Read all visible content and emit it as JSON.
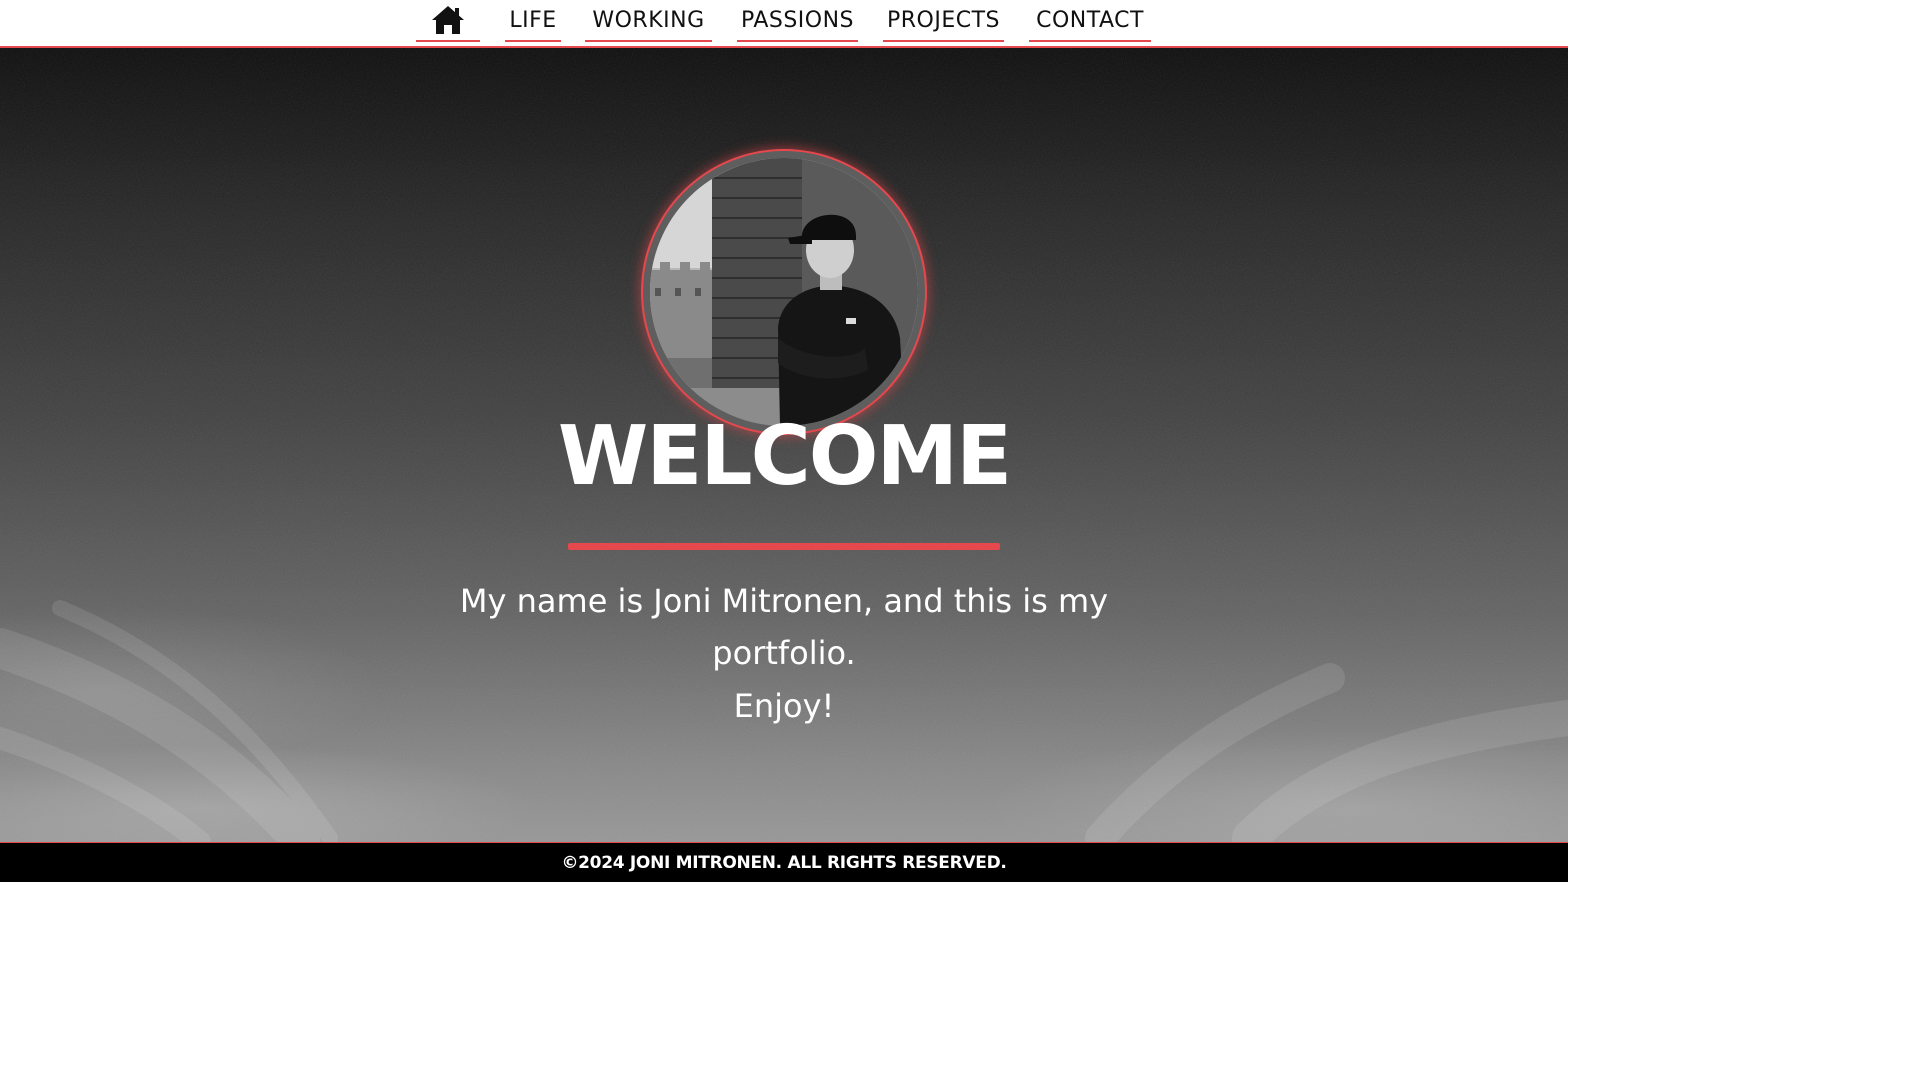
{
  "nav": {
    "home_icon": "home-icon",
    "items": [
      {
        "label": "LIFE"
      },
      {
        "label": "WORKING"
      },
      {
        "label": "PASSIONS"
      },
      {
        "label": "PROJECTS"
      },
      {
        "label": "CONTACT"
      }
    ]
  },
  "hero": {
    "heading": "WELCOME",
    "intro": "My name is Joni Mitronen, and this is my portfolio.",
    "closing": "Enjoy!"
  },
  "footer": {
    "copyright": "©2024 JONI MITRONEN. ALL RIGHTS RESERVED."
  },
  "colors": {
    "accent": "#e5484d",
    "nav_background": "#ffffff",
    "footer_background": "#000000",
    "text_light": "#ffffff"
  }
}
